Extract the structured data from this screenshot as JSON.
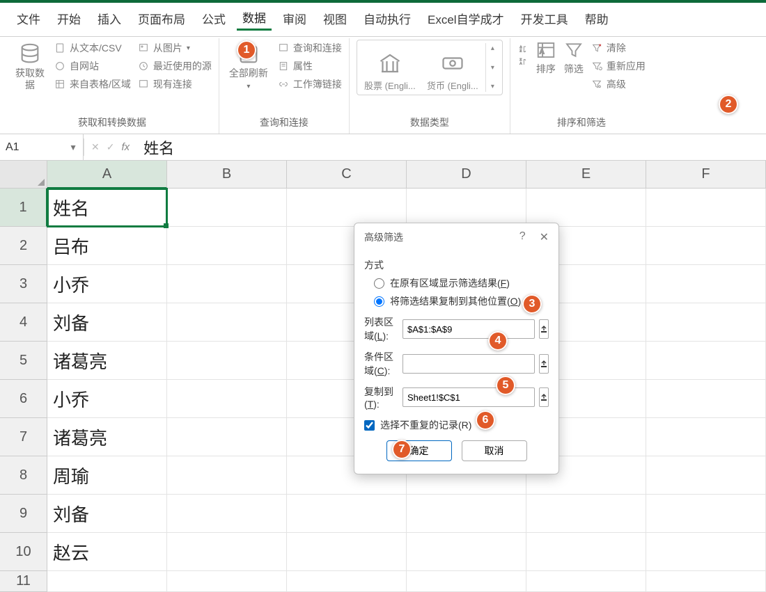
{
  "menu": {
    "items": [
      "文件",
      "开始",
      "插入",
      "页面布局",
      "公式",
      "数据",
      "审阅",
      "视图",
      "自动执行",
      "Excel自学成才",
      "开发工具",
      "帮助"
    ],
    "active_index": 5
  },
  "ribbon": {
    "group1": {
      "big_label": "获取数\n据",
      "items": [
        "从文本/CSV",
        "自网站",
        "来自表格/区域",
        "从图片",
        "最近使用的源",
        "现有连接"
      ],
      "group_label": "获取和转换数据"
    },
    "group2": {
      "big_label": "全部刷新",
      "items": [
        "查询和连接",
        "属性",
        "工作簿链接"
      ],
      "group_label": "查询和连接"
    },
    "group3": {
      "items": [
        "股票 (Engli...",
        "货币 (Engli..."
      ],
      "group_label": "数据类型"
    },
    "group4": {
      "sort_label": "排序",
      "filter_label": "筛选",
      "items": [
        "清除",
        "重新应用",
        "高级"
      ],
      "group_label": "排序和筛选"
    }
  },
  "namebox": {
    "ref": "A1"
  },
  "formula": {
    "value": "姓名"
  },
  "columns": [
    "A",
    "B",
    "C",
    "D",
    "E",
    "F"
  ],
  "rows": [
    {
      "n": "1",
      "a": "姓名"
    },
    {
      "n": "2",
      "a": "吕布"
    },
    {
      "n": "3",
      "a": "小乔"
    },
    {
      "n": "4",
      "a": "刘备"
    },
    {
      "n": "5",
      "a": "诸葛亮"
    },
    {
      "n": "6",
      "a": "小乔"
    },
    {
      "n": "7",
      "a": "诸葛亮"
    },
    {
      "n": "8",
      "a": "周瑜"
    },
    {
      "n": "9",
      "a": "刘备"
    },
    {
      "n": "10",
      "a": "赵云"
    }
  ],
  "dialog": {
    "title": "高级筛选",
    "method_label": "方式",
    "radio1": {
      "text": "在原有区域显示筛选结果(",
      "hot": "F",
      "tail": ")"
    },
    "radio2": {
      "text": "将筛选结果复制到其他位置(",
      "hot": "O",
      "tail": ")"
    },
    "radio_checked": 2,
    "list_range": {
      "label": "列表区域(",
      "hot": "L",
      "tail": "):",
      "value": "$A$1:$A$9"
    },
    "cond_range": {
      "label": "条件区域(",
      "hot": "C",
      "tail": "):",
      "value": ""
    },
    "copy_to": {
      "label": "复制到(",
      "hot": "T",
      "tail": "):",
      "value": "Sheet1!$C$1"
    },
    "unique": {
      "label": "选择不重复的记录(",
      "hot": "R",
      "tail": ")",
      "checked": true
    },
    "ok": "确定",
    "cancel": "取消"
  },
  "callouts": [
    "1",
    "2",
    "3",
    "4",
    "5",
    "6",
    "7"
  ]
}
